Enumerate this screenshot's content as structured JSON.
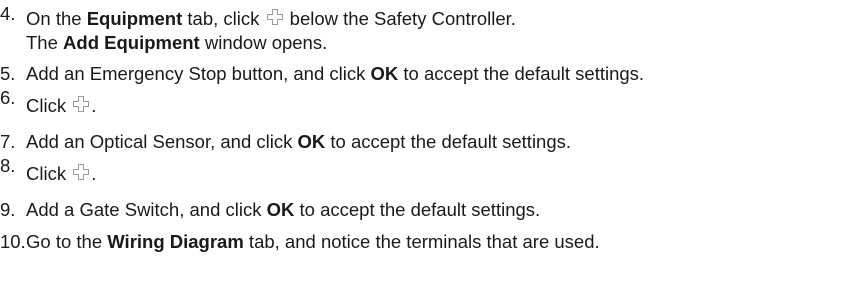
{
  "steps": [
    {
      "number": "4.",
      "line1": {
        "pre": "On the ",
        "b1": "Equipment",
        "mid": " tab, click ",
        "icon": "plus-outline-icon",
        "post": " below the Safety Controller."
      },
      "line2": {
        "pre": "The ",
        "b1": "Add Equipment",
        "post": " window opens."
      }
    },
    {
      "number": "5.",
      "pre": "Add an Emergency Stop button, and click ",
      "b1": "OK",
      "post": " to accept the default settings."
    },
    {
      "number": "6.",
      "pre": "Click ",
      "icon": "plus-outline-icon",
      "post": "."
    },
    {
      "number": "7.",
      "pre": "Add an Optical Sensor, and click ",
      "b1": "OK",
      "post": " to accept the default settings."
    },
    {
      "number": "8.",
      "pre": "Click ",
      "icon": "plus-outline-icon",
      "post": "."
    },
    {
      "number": "9.",
      "pre": "Add a Gate Switch, and click ",
      "b1": "OK",
      "post": " to accept the default settings."
    },
    {
      "number": "10.",
      "pre": "Go to the ",
      "b1": "Wiring Diagram",
      "post": " tab, and notice the terminals that are used."
    }
  ],
  "colors": {
    "text": "#1a1a1a",
    "icon_stroke": "#9a9a9a"
  }
}
